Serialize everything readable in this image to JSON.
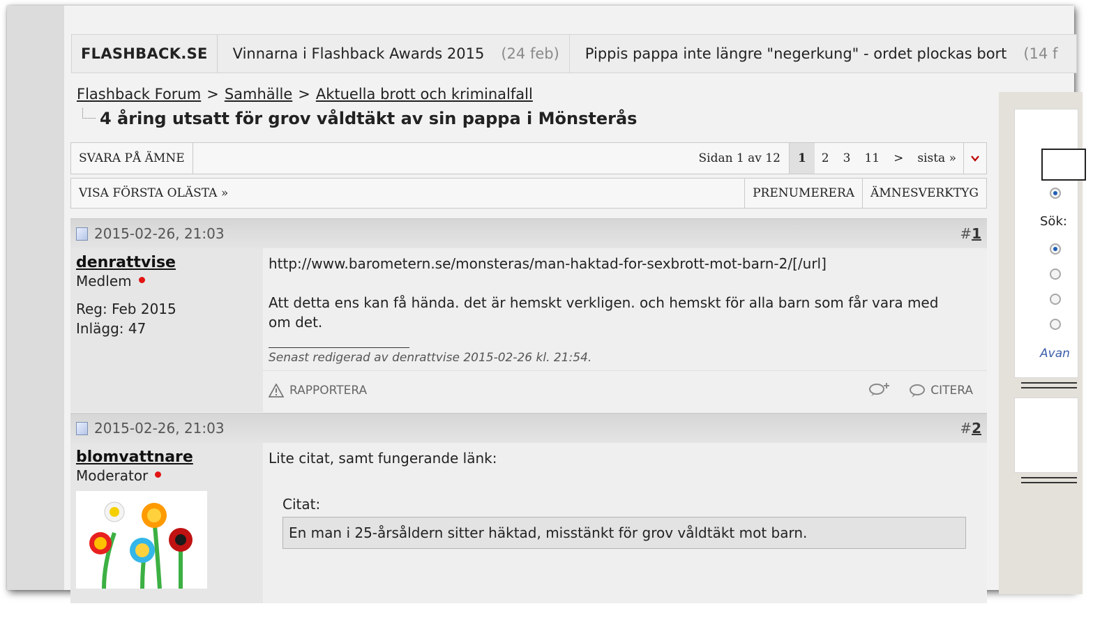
{
  "ticker": {
    "site": "FLASHBACK.SE",
    "items": [
      {
        "text": "Vinnarna i Flashback Awards 2015",
        "date": "(24 feb)"
      },
      {
        "text": "Pippis pappa inte längre \"negerkung\" - ordet plockas bort",
        "date": "(14 f"
      }
    ]
  },
  "breadcrumb": {
    "items": [
      "Flashback Forum",
      "Samhälle",
      "Aktuella brott och kriminalfall"
    ],
    "separator": ">"
  },
  "thread_title": "4 åring utsatt för grov våldtäkt av sin pappa i Mönsterås",
  "toolbar": {
    "reply": "SVARA PÅ ÄMNE",
    "page_info": "Sidan 1 av 12",
    "pages": [
      "1",
      "2",
      "3",
      "11",
      ">",
      "sista »"
    ],
    "first_unread": "VISA FÖRSTA OLÄSTA »",
    "subscribe": "PRENUMERERA",
    "tools": "ÄMNESVERKTYG"
  },
  "posts": [
    {
      "date": "2015-02-26, 21:03",
      "number_prefix": "#",
      "number": "1",
      "username": "denrattvise",
      "role": "Medlem",
      "reg": "Reg: Feb 2015",
      "posts_count": "Inlägg: 47",
      "lines": [
        "http://www.barometern.se/monsteras/man-haktad-for-sexbrott-mot-barn-2/[/url]",
        "Att detta ens kan få hända. det är hemskt verkligen. och hemskt för alla barn som får vara med om det."
      ],
      "edited": "Senast redigerad av denrattvise 2015-02-26 kl. 21:54.",
      "report": "RAPPORTERA",
      "quote": "CITERA"
    },
    {
      "date": "2015-02-26, 21:03",
      "number_prefix": "#",
      "number": "2",
      "username": "blomvattnare",
      "role": "Moderator",
      "intro": "Lite citat, samt fungerande länk:",
      "quote_label": "Citat:",
      "quote_text": "En man i 25-årsåldern sitter häktad, misstänkt för grov våldtäkt mot barn."
    }
  ],
  "sidebar": {
    "search_label": "Sök:",
    "advanced": "Avan"
  },
  "colors": {
    "online_dot": "#e21414",
    "radio_selected": "#1f5fb5",
    "link_blue": "#3a5da8"
  }
}
